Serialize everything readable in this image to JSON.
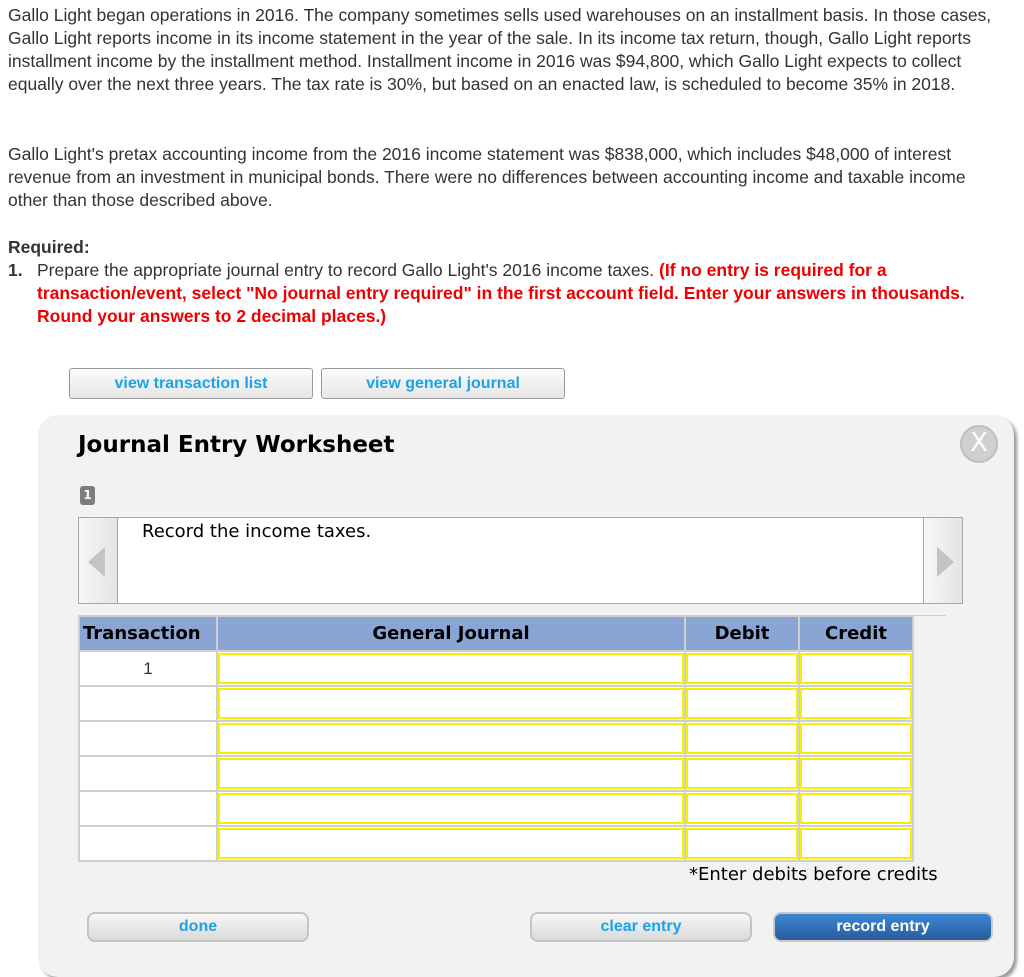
{
  "problem": {
    "paragraph1": "Gallo Light began operations in 2016. The company sometimes sells used warehouses on an installment basis. In those cases, Gallo Light reports income in its income statement in the year of the sale. In its income tax return, though, Gallo Light reports installment income by the installment method. Installment income in 2016 was $94,800, which Gallo Light expects to collect equally over the next three years. The tax rate is 30%, but based on an enacted law, is scheduled to become 35% in 2018.",
    "paragraph2": "Gallo Light's pretax accounting income from the 2016 income statement was $838,000, which includes $48,000 of interest revenue from an investment in municipal bonds. There were no differences between accounting income and taxable income other than those described above.",
    "required_title": "Required:",
    "required_number": "1.",
    "required_text": "Prepare the appropriate journal entry to record Gallo Light's 2016 income taxes.",
    "required_instruction": "(If no entry is required for a transaction/event, select \"No journal entry required\" in the first account field. Enter your answers in thousands. Round your answers to 2 decimal places.)"
  },
  "toolbar": {
    "view_transaction_list": "view transaction list",
    "view_general_journal": "view general journal"
  },
  "worksheet": {
    "title": "Journal Entry Worksheet",
    "close_icon": "close-icon",
    "close_glyph": "X",
    "current_page": "1",
    "description": "Record the income taxes.",
    "columns": [
      "Transaction",
      "General Journal",
      "Debit",
      "Credit"
    ],
    "rows": [
      {
        "transaction": "1",
        "account": "",
        "debit": "",
        "credit": ""
      },
      {
        "transaction": "",
        "account": "",
        "debit": "",
        "credit": ""
      },
      {
        "transaction": "",
        "account": "",
        "debit": "",
        "credit": ""
      },
      {
        "transaction": "",
        "account": "",
        "debit": "",
        "credit": ""
      },
      {
        "transaction": "",
        "account": "",
        "debit": "",
        "credit": ""
      },
      {
        "transaction": "",
        "account": "",
        "debit": "",
        "credit": ""
      }
    ],
    "note": "*Enter debits before credits",
    "buttons": {
      "done": "done",
      "clear_entry": "clear entry",
      "record_entry": "record entry"
    }
  },
  "colors": {
    "instruction_red": "#ee0000",
    "link_blue": "#1aa3e8",
    "header_blue": "#8aa4d4",
    "input_border_yellow": "#f6f000",
    "record_button_blue": "#2a5a9a"
  }
}
